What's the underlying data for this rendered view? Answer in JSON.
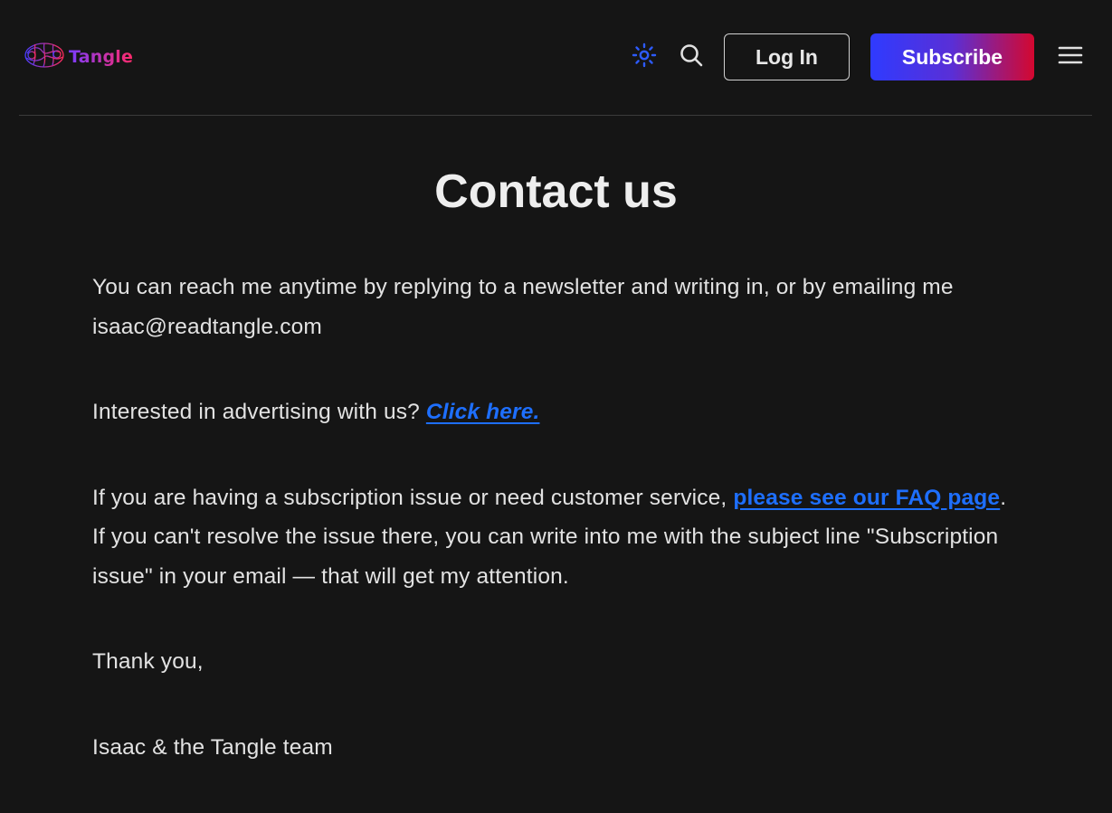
{
  "header": {
    "logo_text": "Tangle",
    "login_label": "Log In",
    "subscribe_label": "Subscribe",
    "icons": {
      "theme": "sun-icon",
      "search": "search-icon",
      "menu": "hamburger-menu-icon",
      "logo": "brain-logo-icon"
    }
  },
  "colors": {
    "background": "#151515",
    "link": "#1e6fff",
    "accent_blue": "#2f3bff",
    "accent_red": "#d4082f"
  },
  "main": {
    "title": "Contact us",
    "p1_text": "You can reach me anytime by replying to a newsletter and writing in, or by emailing me isaac@readtangle.com",
    "p2_text": "Interested in advertising with us? ",
    "p2_link": "Click here.",
    "p3_text_before": "If you are having a subscription issue or need customer service, ",
    "p3_link": "please see our FAQ page",
    "p3_text_after": ". If you can't resolve the issue there, you can write into me with the subject line \"Subscription issue\" in your email — that will get my attention.",
    "p4_text": "Thank you,",
    "p5_text": "Isaac & the Tangle team"
  }
}
